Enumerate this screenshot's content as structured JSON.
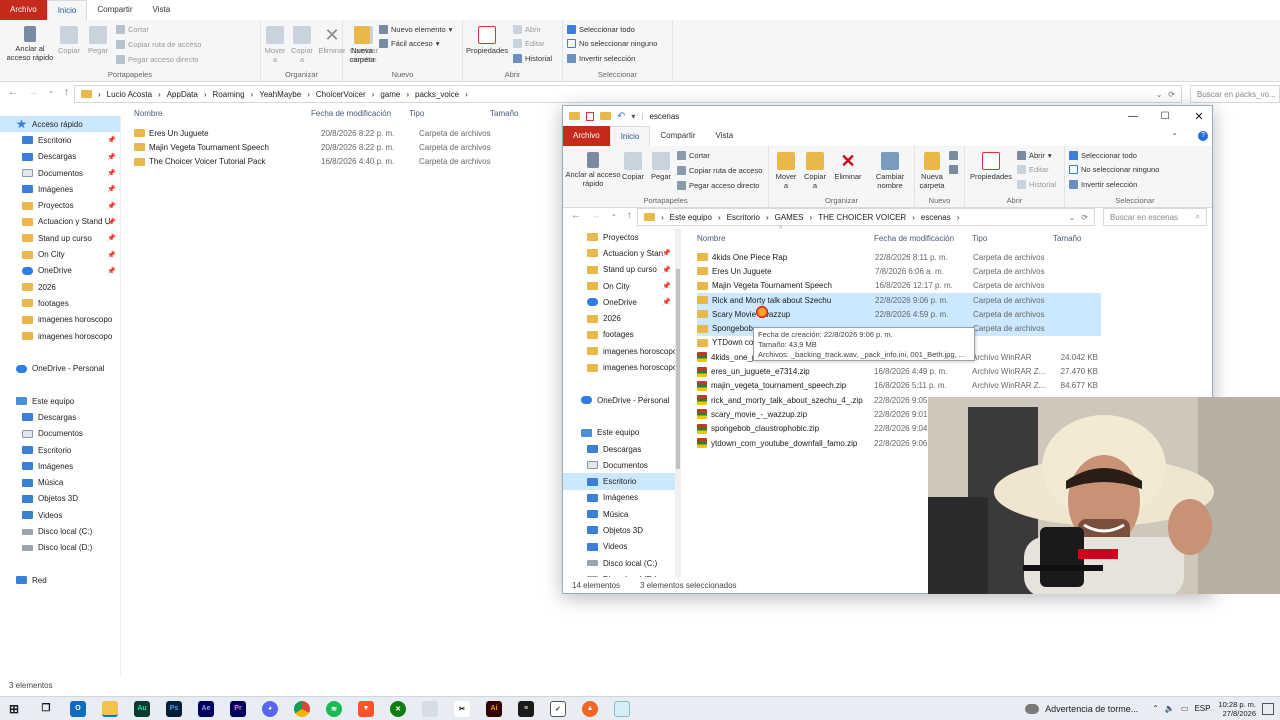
{
  "bg": {
    "tabs": [
      "Archivo",
      "Inicio",
      "Compartir",
      "Vista"
    ],
    "ribbon": {
      "pin": "Anclar al acceso rápido",
      "copy": "Copiar",
      "paste": "Pegar",
      "cut": "Cortar",
      "copy_path": "Copiar ruta de acceso",
      "paste_shortcut": "Pegar acceso directo",
      "move": "Mover a",
      "copy_to": "Copiar a",
      "delete": "Eliminar",
      "rename": "Cambiar nombre",
      "new_folder": "Nueva carpeta",
      "new_item": "Nuevo elemento",
      "easy_access": "Fácil acceso",
      "properties": "Propiedades",
      "open": "Abrir",
      "edit": "Editar",
      "history": "Historial",
      "select_all": "Seleccionar todo",
      "select_none": "No seleccionar ninguno",
      "invert": "Invertir selección",
      "groups": [
        "Portapapeles",
        "Organizar",
        "Nuevo",
        "Abrir",
        "Seleccionar"
      ]
    },
    "path": [
      "Lucio Acosta",
      "AppData",
      "Roaming",
      "YeahMaybe",
      "ChoicerVoicer",
      "game",
      "packs_voice"
    ],
    "search_placeholder": "Buscar en packs_vo...",
    "sidebar": [
      {
        "label": "Acceso rápido",
        "kind": "quick",
        "pinned": false
      },
      {
        "label": "Escritorio",
        "kind": "blue",
        "pinned": true
      },
      {
        "label": "Descargas",
        "kind": "blue",
        "pinned": true
      },
      {
        "label": "Documentos",
        "kind": "doc",
        "pinned": true
      },
      {
        "label": "Imágenes",
        "kind": "blue",
        "pinned": true
      },
      {
        "label": "Proyectos",
        "kind": "folder",
        "pinned": true
      },
      {
        "label": "Actuacion y Stand U",
        "kind": "folder",
        "pinned": true
      },
      {
        "label": "Stand up curso",
        "kind": "folder",
        "pinned": true
      },
      {
        "label": "On City",
        "kind": "folder",
        "pinned": true
      },
      {
        "label": "OneDrive",
        "kind": "cloud",
        "pinned": true
      },
      {
        "label": "2026",
        "kind": "folder",
        "pinned": false
      },
      {
        "label": "footages",
        "kind": "folder",
        "pinned": false
      },
      {
        "label": "imagenes horoscopo",
        "kind": "folder",
        "pinned": false
      },
      {
        "label": "imagenes horoscopo",
        "kind": "folder",
        "pinned": false
      },
      {
        "label": "",
        "kind": "gap",
        "pinned": false
      },
      {
        "label": "OneDrive - Personal",
        "kind": "cloud",
        "pinned": false
      },
      {
        "label": "",
        "kind": "gap",
        "pinned": false
      },
      {
        "label": "Este equipo",
        "kind": "pc",
        "pinned": false
      },
      {
        "label": "Descargas",
        "kind": "blue",
        "pinned": false
      },
      {
        "label": "Documentos",
        "kind": "doc",
        "pinned": false
      },
      {
        "label": "Escritorio",
        "kind": "blue",
        "pinned": false
      },
      {
        "label": "Imágenes",
        "kind": "blue",
        "pinned": false
      },
      {
        "label": "Música",
        "kind": "blue",
        "pinned": false
      },
      {
        "label": "Objetos 3D",
        "kind": "blue",
        "pinned": false
      },
      {
        "label": "Videos",
        "kind": "blue",
        "pinned": false
      },
      {
        "label": "Disco local (C:)",
        "kind": "disk",
        "pinned": false
      },
      {
        "label": "Disco local (D:)",
        "kind": "disk",
        "pinned": false
      },
      {
        "label": "",
        "kind": "gap",
        "pinned": false
      },
      {
        "label": "Red",
        "kind": "blue",
        "pinned": false
      }
    ],
    "headers": [
      "Nombre",
      "Fecha de modificación",
      "Tipo",
      "Tamaño"
    ],
    "files": [
      {
        "name": "Eres Un Juguete",
        "date": "20/8/2026 8:22 p. m.",
        "type": "Carpeta de archivos"
      },
      {
        "name": "Majin Vegeta Tournament Speech",
        "date": "20/8/2026 8:22 p. m.",
        "type": "Carpeta de archivos"
      },
      {
        "name": "The Choicer Voicer Tutorial Pack",
        "date": "16/8/2026 4:40 p. m.",
        "type": "Carpeta de archivos"
      }
    ],
    "status": "3 elementos"
  },
  "fg": {
    "title": "escenas",
    "path": [
      "Este equipo",
      "Escritorio",
      "GAMES",
      "THE CHOICER VOICER",
      "escenas"
    ],
    "search_placeholder": "Buscar en escenas",
    "sidebar": [
      {
        "label": "Proyectos",
        "kind": "folder",
        "pinned": false
      },
      {
        "label": "Actuacion y Stan",
        "kind": "folder",
        "pinned": true
      },
      {
        "label": "Stand up curso",
        "kind": "folder",
        "pinned": true
      },
      {
        "label": "On City",
        "kind": "folder",
        "pinned": true
      },
      {
        "label": "OneDrive",
        "kind": "cloud",
        "pinned": true
      },
      {
        "label": "2026",
        "kind": "folder",
        "pinned": false
      },
      {
        "label": "footages",
        "kind": "folder",
        "pinned": false
      },
      {
        "label": "imagenes horoscopo",
        "kind": "folder",
        "pinned": false
      },
      {
        "label": "imagenes horoscopo",
        "kind": "folder",
        "pinned": false
      },
      {
        "label": "",
        "kind": "gap",
        "pinned": false
      },
      {
        "label": "OneDrive - Personal",
        "kind": "cloud",
        "pinned": false
      },
      {
        "label": "",
        "kind": "gap",
        "pinned": false
      },
      {
        "label": "Este equipo",
        "kind": "pc",
        "pinned": false
      },
      {
        "label": "Descargas",
        "kind": "blue",
        "pinned": false
      },
      {
        "label": "Documentos",
        "kind": "doc",
        "pinned": false
      },
      {
        "label": "Escritorio",
        "kind": "blue",
        "pinned": false
      },
      {
        "label": "Imágenes",
        "kind": "blue",
        "pinned": false
      },
      {
        "label": "Música",
        "kind": "blue",
        "pinned": false
      },
      {
        "label": "Objetos 3D",
        "kind": "blue",
        "pinned": false
      },
      {
        "label": "Videos",
        "kind": "blue",
        "pinned": false
      },
      {
        "label": "Disco local (C:)",
        "kind": "disk",
        "pinned": false
      },
      {
        "label": "Disco local (D:)",
        "kind": "disk",
        "pinned": false
      }
    ],
    "headers": [
      "Nombre",
      "Fecha de modificación",
      "Tipo",
      "Tamaño"
    ],
    "files": [
      {
        "name": "4kids One Piece Rap",
        "date": "22/8/2026 8:11 p. m.",
        "type": "Carpeta de archivos",
        "size": "",
        "kind": "folder",
        "selected": false
      },
      {
        "name": "Eres Un Juguete",
        "date": "7/8/2026 6:06 a. m.",
        "type": "Carpeta de archivos",
        "size": "",
        "kind": "folder",
        "selected": false
      },
      {
        "name": "Majin Vegeta Tournament Speech",
        "date": "16/8/2026 12:17 p. m.",
        "type": "Carpeta de archivos",
        "size": "",
        "kind": "folder",
        "selected": false
      },
      {
        "name": "Rick and Morty talk about Szechu",
        "date": "22/8/2026 9:06 p. m.",
        "type": "Carpeta de archivos",
        "size": "",
        "kind": "folder",
        "selected": true
      },
      {
        "name": "Scary Movie - wazzup",
        "date": "22/8/2026 4:59 p. m.",
        "type": "Carpeta de archivos",
        "size": "",
        "kind": "folder",
        "selected": true
      },
      {
        "name": "Spongebob",
        "date": "",
        "type": "Carpeta de archivos",
        "size": "",
        "kind": "folder",
        "selected": true
      },
      {
        "name": "YTDown co",
        "date": "",
        "type": "",
        "size": "",
        "kind": "folder",
        "selected": false
      },
      {
        "name": "4kids_one_p",
        "date": "",
        "type": "Archivo WinRAR",
        "size": "24.042 KB",
        "kind": "zip",
        "selected": false
      },
      {
        "name": "eres_un_juguete_e7314.zip",
        "date": "16/8/2026 4:49 p. m.",
        "type": "Archivo WinRAR Z...",
        "size": "27.470 KB",
        "kind": "zip",
        "selected": false
      },
      {
        "name": "majin_vegeta_tournament_speech.zip",
        "date": "16/8/2026 5:11 p. m.",
        "type": "Archivo WinRAR Z...",
        "size": "84.677 KB",
        "kind": "zip",
        "selected": false
      },
      {
        "name": "rick_and_morty_talk_about_szechu_4_.zip",
        "date": "22/8/2026 9:05",
        "type": "",
        "size": "",
        "kind": "zip",
        "selected": false
      },
      {
        "name": "scary_movie_-_wazzup.zip",
        "date": "22/8/2026 9:01",
        "type": "",
        "size": "",
        "kind": "zip",
        "selected": false
      },
      {
        "name": "spongebob_claustrophobic.zip",
        "date": "22/8/2026 9:04",
        "type": "",
        "size": "",
        "kind": "zip",
        "selected": false
      },
      {
        "name": "ytdown_com_youtube_downfall_famo.zip",
        "date": "22/8/2026 9:06",
        "type": "",
        "size": "",
        "kind": "zip",
        "selected": false
      }
    ],
    "tooltip": {
      "created": "Fecha de creación: 22/8/2026 9:06 p. m.",
      "size": "Tamaño: 43,9 MB",
      "files": "Archivos: _backing_track.wav, _pack_info.ini, 001_Beth.jpg, ..."
    },
    "status_count": "14 elementos",
    "status_selected": "3 elementos seleccionados"
  },
  "taskbar": {
    "notification": "Advertencia de torme...",
    "lang": "ESP",
    "time": "10:28 p. m.",
    "date": "27/8/2026",
    "icons": [
      "windows-icon",
      "task-view-icon",
      "outlook-icon",
      "file-explorer-icon",
      "audition-icon",
      "photoshop-icon",
      "after-effects-icon",
      "premiere-icon",
      "discord-icon",
      "chrome-icon",
      "spotify-icon",
      "brave-icon",
      "xbox-icon",
      "app-icon",
      "capcut-icon",
      "illustrator-icon",
      "app-icon-2",
      "app-icon-3",
      "app-icon-4",
      "app-icon-5"
    ]
  },
  "colors": {
    "accent": "#0078d7",
    "file_tab": "#c42b1c",
    "folder": "#e8b84a",
    "selection": "#cce8ff"
  }
}
